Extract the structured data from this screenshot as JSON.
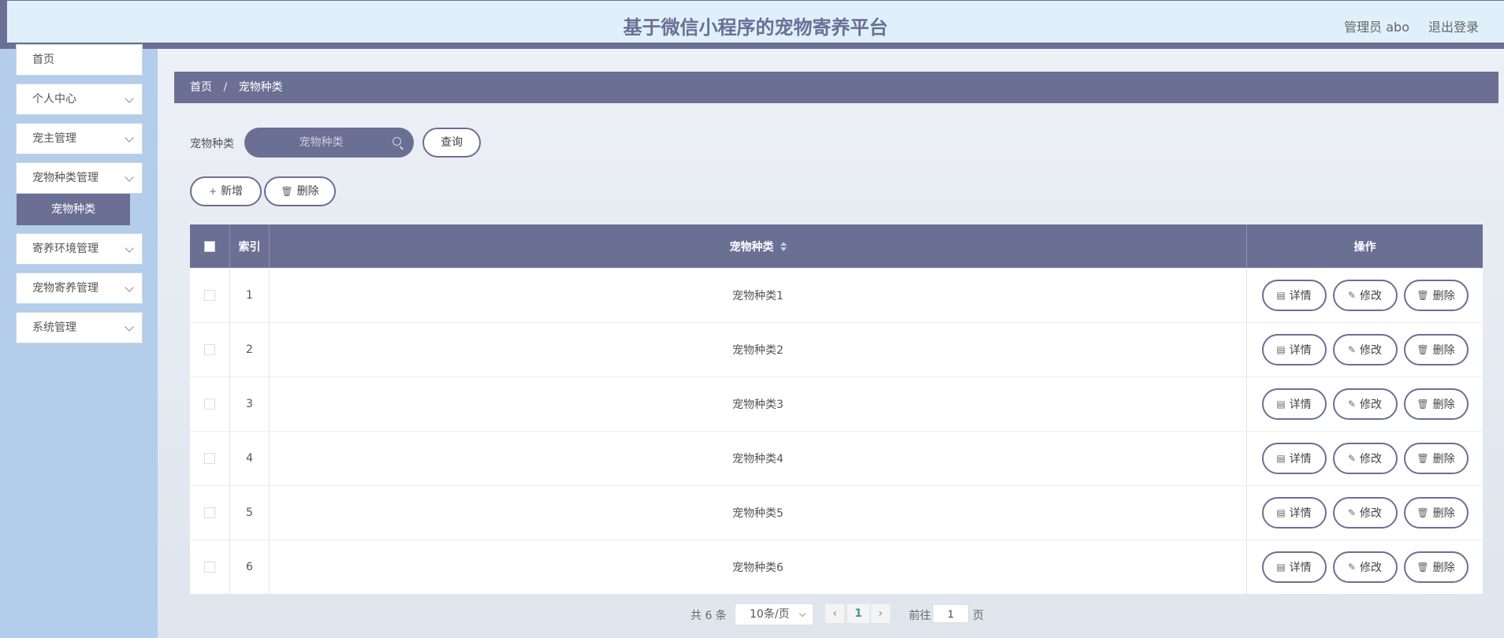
{
  "header": {
    "title": "基于微信小程序的宠物寄养平台",
    "user": "管理员 abo",
    "logout": "退出登录"
  },
  "sidebar": {
    "items": [
      {
        "label": "首页"
      },
      {
        "label": "个人中心"
      },
      {
        "label": "宠主管理"
      },
      {
        "label": "宠物种类管理"
      },
      {
        "label": "寄养环境管理"
      },
      {
        "label": "宠物寄养管理"
      },
      {
        "label": "系统管理"
      }
    ],
    "active_sub": "宠物种类"
  },
  "breadcrumb": {
    "home": "首页",
    "sep": "/",
    "current": "宠物种类"
  },
  "search": {
    "label": "宠物种类",
    "placeholder": "宠物种类",
    "query_button": "查询"
  },
  "actions": {
    "add": "新增",
    "delete": "删除"
  },
  "table": {
    "headers": {
      "index": "索引",
      "type": "宠物种类",
      "ops": "操作"
    },
    "rows": [
      {
        "index": "1",
        "type": "宠物种类1"
      },
      {
        "index": "2",
        "type": "宠物种类2"
      },
      {
        "index": "3",
        "type": "宠物种类3"
      },
      {
        "index": "4",
        "type": "宠物种类4"
      },
      {
        "index": "5",
        "type": "宠物种类5"
      },
      {
        "index": "6",
        "type": "宠物种类6"
      }
    ],
    "row_actions": {
      "detail": "详情",
      "edit": "修改",
      "delete": "删除"
    }
  },
  "pagination": {
    "total": "共 6 条",
    "page_size": "10条/页",
    "current": "1",
    "goto_label": "前往",
    "goto_value": "1",
    "page_suffix": "页"
  },
  "colors": {
    "accent": "#6b6f94",
    "header_bg": "#dff0fa",
    "sidebar_bg": "#b3cdea"
  }
}
